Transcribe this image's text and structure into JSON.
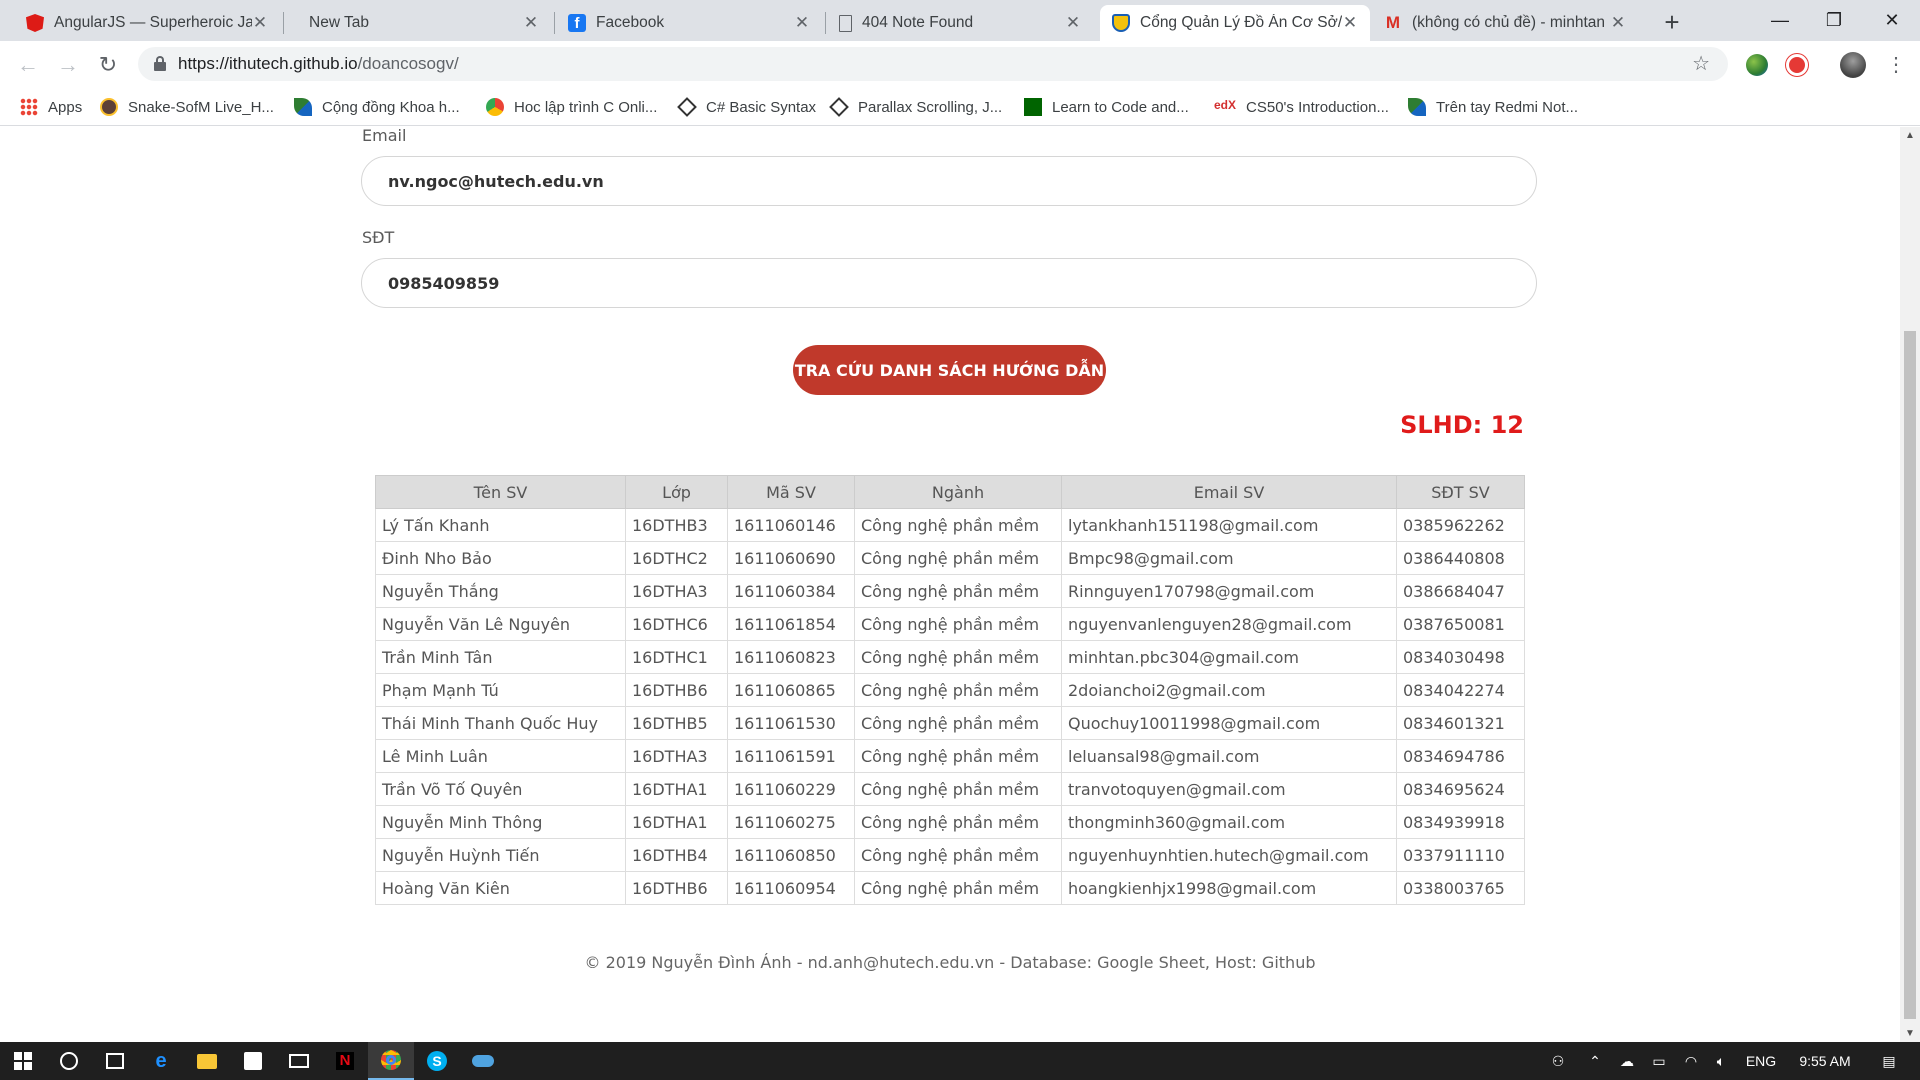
{
  "browser": {
    "tabs": [
      {
        "title": "AngularJS — Superheroic Jav",
        "icon": "angular-icon",
        "color": "#dd1b16"
      },
      {
        "title": "New Tab",
        "icon": "",
        "color": ""
      },
      {
        "title": "Facebook",
        "icon": "facebook-icon",
        "color": "#1877f2"
      },
      {
        "title": "404 Note Found",
        "icon": "document-icon",
        "color": "#5f6368"
      },
      {
        "title": "Cổng Quản Lý Đồ Án Cơ Sở/",
        "icon": "hutech-shield-icon",
        "color": "#1a5fb4"
      },
      {
        "title": "(không có chủ đề) - minhtan",
        "icon": "gmail-icon",
        "color": "#d93025"
      }
    ],
    "active_tab_index": 4,
    "url_host": "https://ithutech.github.io",
    "url_path": "/doancosogv/",
    "bookmarks": [
      {
        "label": "Apps",
        "icon": "apps-grid-icon"
      },
      {
        "label": "Snake-SofM Live_H...",
        "icon": "owl-icon"
      },
      {
        "label": "Cộng đồng Khoa h...",
        "icon": "leaf-icon"
      },
      {
        "label": "Hoc lập trình C Onli...",
        "icon": "globe-icon"
      },
      {
        "label": "C# Basic Syntax",
        "icon": "diamond-icon"
      },
      {
        "label": "Parallax Scrolling, J...",
        "icon": "diamond-icon"
      },
      {
        "label": "Learn to Code and...",
        "icon": "fcc-icon"
      },
      {
        "label": "CS50's Introduction...",
        "icon": "edx-icon"
      },
      {
        "label": "Trên tay Redmi Not...",
        "icon": "leaf-icon"
      }
    ]
  },
  "form": {
    "email_label": "Email",
    "email_value": "nv.ngoc@hutech.edu.vn",
    "phone_label": "SĐT",
    "phone_value": "0985409859",
    "search_button": "TRA CỨU DANH SÁCH HƯỚNG DẪN"
  },
  "count_label": "SLHD: 12",
  "table": {
    "headers": [
      "Tên SV",
      "Lớp",
      "Mã SV",
      "Ngành",
      "Email SV",
      "SĐT SV"
    ],
    "rows": [
      [
        "Lý Tấn Khanh",
        "16DTHB3",
        "1611060146",
        "Công nghệ phần mềm",
        "lytankhanh151198@gmail.com",
        "0385962262"
      ],
      [
        "Đinh Nho Bảo",
        "16DTHC2",
        "1611060690",
        "Công nghệ phần mềm",
        "Bmpc98@gmail.com",
        "0386440808"
      ],
      [
        "Nguyễn Thắng",
        "16DTHA3",
        "1611060384",
        "Công nghệ phần mềm",
        "Rinnguyen170798@gmail.com",
        "0386684047"
      ],
      [
        "Nguyễn Văn Lê Nguyên",
        "16DTHC6",
        "1611061854",
        "Công nghệ phần mềm",
        "nguyenvanlenguyen28@gmail.com",
        "0387650081"
      ],
      [
        "Trần Minh Tân",
        "16DTHC1",
        "1611060823",
        "Công nghệ phần mềm",
        "minhtan.pbc304@gmail.com",
        "0834030498"
      ],
      [
        "Phạm Mạnh Tú",
        "16DTHB6",
        "1611060865",
        "Công nghệ phần mềm",
        "2doianchoi2@gmail.com",
        "0834042274"
      ],
      [
        "Thái Minh Thanh Quốc Huy",
        "16DTHB5",
        "1611061530",
        "Công nghệ phần mềm",
        "Quochuy10011998@gmail.com",
        "0834601321"
      ],
      [
        "Lê Minh Luân",
        "16DTHA3",
        "1611061591",
        "Công nghệ phần mềm",
        "leluansal98@gmail.com",
        "0834694786"
      ],
      [
        "Trần Võ Tố Quyên",
        "16DTHA1",
        "1611060229",
        "Công nghệ phần mềm",
        "tranvotoquyen@gmail.com",
        "0834695624"
      ],
      [
        "Nguyễn Minh Thông",
        "16DTHA1",
        "1611060275",
        "Công nghệ phần mềm",
        "thongminh360@gmail.com",
        "0834939918"
      ],
      [
        "Nguyễn Huỳnh Tiến",
        "16DTHB4",
        "1611060850",
        "Công nghệ phần mềm",
        "nguyenhuynhtien.hutech@gmail.com",
        "0337911110"
      ],
      [
        "Hoàng Văn Kiên",
        "16DTHB6",
        "1611060954",
        "Công nghệ phần mềm",
        "hoangkienhjx1998@gmail.com",
        "0338003765"
      ]
    ]
  },
  "footer": "© 2019 Nguyễn Đình Ánh - nd.anh@hutech.edu.vn - Database: Google Sheet, Host: Github",
  "taskbar": {
    "language": "ENG",
    "time": "9:55 AM"
  },
  "colors": {
    "accent_button": "#c0392b",
    "count_red": "#e01b1b",
    "table_header_bg": "#dddddd"
  }
}
